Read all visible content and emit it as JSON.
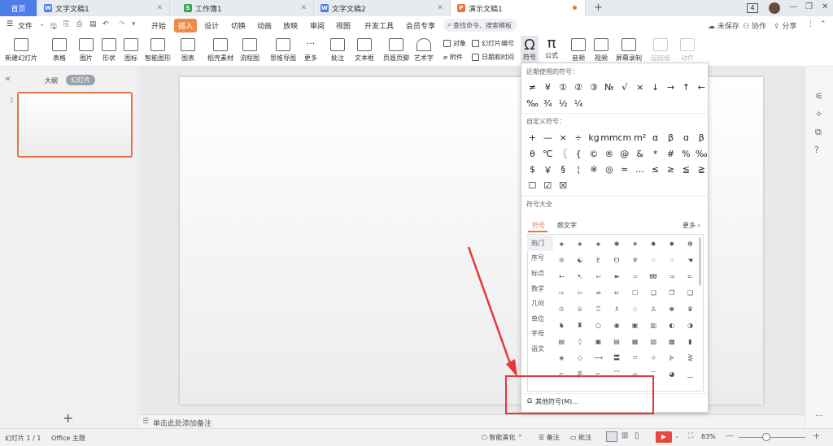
{
  "tabs": [
    {
      "label": "首页"
    },
    {
      "label": "文字文稿1",
      "icon": "W"
    },
    {
      "label": "工作簿1",
      "icon": "S"
    },
    {
      "label": "文字文稿2",
      "icon": "W"
    },
    {
      "label": "演示文稿1",
      "icon": "P"
    }
  ],
  "window": {
    "badge": "4",
    "add": "+",
    "min": "—",
    "restore": "❐",
    "close": "✕"
  },
  "menu": {
    "file": "文件",
    "items": [
      "开始",
      "插入",
      "设计",
      "切换",
      "动画",
      "放映",
      "审阅",
      "视图",
      "开发工具",
      "会员专享"
    ],
    "active": "插入",
    "search_placeholder": "查找命令、搜索模板",
    "unsaved": "未保存",
    "collab": "协作",
    "share": "分享"
  },
  "ribbon": {
    "buttons": [
      "新建幻灯片",
      "表格",
      "图片",
      "形状",
      "图标",
      "智能图形",
      "图表",
      "稻壳素材",
      "流程图",
      "思维导图",
      "更多",
      "批注",
      "文本框",
      "页眉页脚",
      "艺术字",
      "符号",
      "公式",
      "音频",
      "视频",
      "屏幕录制",
      "超链接",
      "动作"
    ],
    "small": [
      "对象",
      "幻灯片编号",
      "附件",
      "日期和时间"
    ]
  },
  "left": {
    "outline": "大纲",
    "slides": "幻灯片",
    "slide_num": "1",
    "add": "+"
  },
  "notes": {
    "placeholder": "单击此处添加备注"
  },
  "status": {
    "slide_count": "幻灯片 1 / 1",
    "theme": "Office 主题",
    "beautify": "智能美化",
    "notes": "备注",
    "comment": "批注",
    "zoom": "83%"
  },
  "popup": {
    "recent_title": "近期使用的符号：",
    "recent": [
      "≠",
      "¥",
      "①",
      "②",
      "③",
      "№",
      "√",
      "×",
      "↓",
      "→",
      "↑",
      "←",
      "‰",
      "¾",
      "½",
      "¼"
    ],
    "custom_title": "自定义符号：",
    "custom": [
      "+",
      "—",
      "×",
      "÷",
      "kg",
      "mm",
      "cm",
      "m²",
      "α",
      "β",
      "ɑ",
      "β",
      "θ",
      "℃",
      "〖",
      "{",
      "©",
      "®",
      "@",
      "&",
      "*",
      "#",
      "%",
      "‰",
      "$",
      "￥",
      "§",
      "¦",
      "※",
      "◎",
      "≈",
      "…",
      "≤",
      "≥",
      "≦",
      "≧",
      "☐",
      "☑",
      "☒"
    ],
    "all_title": "符号大全",
    "tab_symbols": "符号",
    "tab_kaomoji": "颜文字",
    "more": "更多",
    "categories": [
      "热门",
      "序号",
      "标点",
      "数学",
      "几何",
      "单位",
      "字母",
      "语文"
    ],
    "grid": [
      "★",
      "★",
      "★",
      "✱",
      "✷",
      "✸",
      "✹",
      "❆",
      "❊",
      "☯",
      "♇",
      "☋",
      "♆",
      "☜",
      "☞",
      "☚",
      "➸",
      "➷",
      "➵",
      "➽",
      "➾",
      "➿",
      "⇒",
      "⇐",
      "⇨",
      "⇦",
      "⇏",
      "⇐",
      "☐",
      "❏",
      "❐",
      "❑",
      "♔",
      "♕",
      "♖",
      "♗",
      "♘",
      "♙",
      "♚",
      "♛",
      "♞",
      "♜",
      "○",
      "◉",
      "▣",
      "▥",
      "◐",
      "◑",
      "▤",
      "◊",
      "▣",
      "▤",
      "▦",
      "▧",
      "▩",
      "▮",
      "◈",
      "◇",
      "⟶",
      "〓",
      "⌑",
      "⊹",
      "⊱",
      "⋛",
      "⌐",
      "⋚",
      "⌐",
      "⌒",
      "⌓",
      "⌔",
      "◕",
      "‿"
    ],
    "other": "其他符号(M)..."
  }
}
